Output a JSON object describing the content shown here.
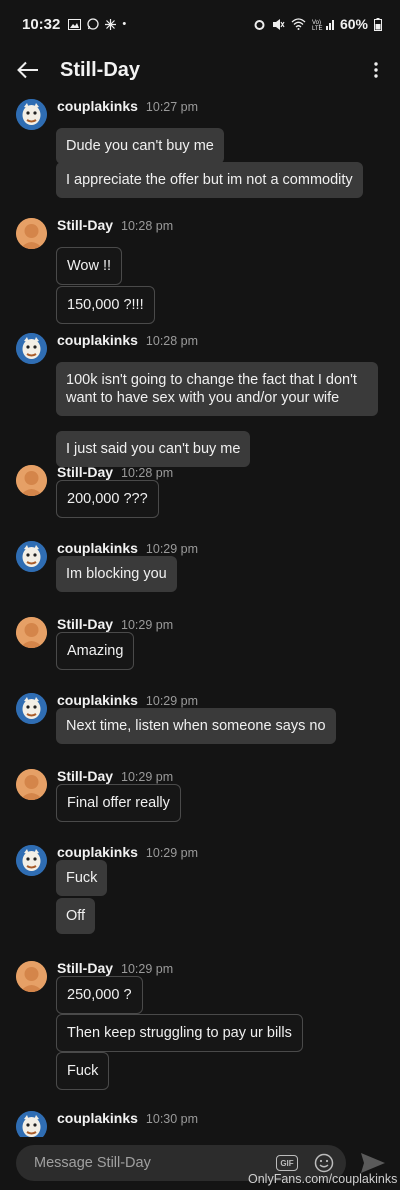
{
  "status_bar": {
    "time": "10:32",
    "battery": "60%"
  },
  "header": {
    "title": "Still-Day"
  },
  "groups": [
    {
      "sender": "couplakinks",
      "time": "10:27 pm",
      "avatar": "blue",
      "messages": [
        {
          "text": "Dude you can't buy me",
          "style": "recv"
        },
        {
          "text": "I appreciate the offer but im not a commodity",
          "style": "recv"
        }
      ]
    },
    {
      "sender": "Still-Day",
      "time": "10:28 pm",
      "avatar": "orange",
      "messages": [
        {
          "text": "Wow !!",
          "style": "sent"
        },
        {
          "text": "150,000 ?!!!",
          "style": "sent"
        }
      ]
    },
    {
      "sender": "couplakinks",
      "time": "10:28 pm",
      "avatar": "blue",
      "messages": [
        {
          "text": "100k isn't going to change the fact that I don't want to have sex with you and/or your wife",
          "style": "recv"
        },
        {
          "text": "I just said you can't buy me",
          "style": "recv"
        }
      ]
    },
    {
      "sender": "Still-Day",
      "time": "10:28 pm",
      "avatar": "orange",
      "messages": [
        {
          "text": "200,000 ???",
          "style": "sent"
        }
      ]
    },
    {
      "sender": "couplakinks",
      "time": "10:29 pm",
      "avatar": "blue",
      "messages": [
        {
          "text": "Im blocking you",
          "style": "recv"
        }
      ]
    },
    {
      "sender": "Still-Day",
      "time": "10:29 pm",
      "avatar": "orange",
      "messages": [
        {
          "text": "Amazing",
          "style": "sent"
        }
      ]
    },
    {
      "sender": "couplakinks",
      "time": "10:29 pm",
      "avatar": "blue",
      "messages": [
        {
          "text": "Next time, listen when someone says no",
          "style": "recv"
        }
      ]
    },
    {
      "sender": "Still-Day",
      "time": "10:29 pm",
      "avatar": "orange",
      "messages": [
        {
          "text": "Final offer really",
          "style": "sent"
        }
      ]
    },
    {
      "sender": "couplakinks",
      "time": "10:29 pm",
      "avatar": "blue",
      "messages": [
        {
          "text": "Fuck",
          "style": "recv"
        },
        {
          "text": "Off",
          "style": "recv"
        }
      ]
    },
    {
      "sender": "Still-Day",
      "time": "10:29 pm",
      "avatar": "orange",
      "messages": [
        {
          "text": "250,000 ?",
          "style": "sent"
        },
        {
          "text": "Then keep struggling to pay ur bills",
          "style": "sent"
        },
        {
          "text": "Fuck",
          "style": "sent"
        }
      ]
    },
    {
      "sender": "couplakinks",
      "time": "10:30 pm",
      "avatar": "blue",
      "messages": []
    }
  ],
  "composer": {
    "placeholder": "Message Still-Day",
    "gif_label": "GIF"
  },
  "icons": {
    "back": "arrow-left-icon",
    "menu": "more-vert-icon",
    "emoji": "smiley-icon",
    "send": "send-icon"
  },
  "watermark": "OnlyFans.com/couplakinks"
}
